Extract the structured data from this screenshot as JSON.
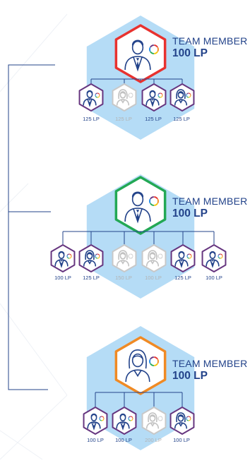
{
  "accent_color": "#23438a",
  "hexagon_fill": "#b5dcf6",
  "sub_hex_active_border": "#66357f",
  "sub_hex_inactive_border": "#c8c8c8",
  "groups": [
    {
      "role": "TEAM MEMBER",
      "points": "100 LP",
      "border_color": "#e8322f",
      "avatar": "male-icon",
      "subs": [
        {
          "label": "125 LP",
          "avatar": "male-icon",
          "active": true
        },
        {
          "label": "125 LP",
          "avatar": "female-icon",
          "active": false
        },
        {
          "label": "125 LP",
          "avatar": "male-icon",
          "active": true
        },
        {
          "label": "125 LP",
          "avatar": "female-icon",
          "active": true
        }
      ]
    },
    {
      "role": "TEAM MEMBER",
      "points": "100 LP",
      "border_color": "#23a855",
      "avatar": "male-icon",
      "subs": [
        {
          "label": "100 LP",
          "avatar": "male-icon",
          "active": true
        },
        {
          "label": "125 LP",
          "avatar": "female-icon",
          "active": true
        },
        {
          "label": "150 LP",
          "avatar": "female-icon",
          "active": false
        },
        {
          "label": "100 LP",
          "avatar": "female-icon",
          "active": false
        },
        {
          "label": "125 LP",
          "avatar": "male-icon",
          "active": true
        },
        {
          "label": "100 LP",
          "avatar": "male-icon",
          "active": true
        }
      ]
    },
    {
      "role": "TEAM MEMBER",
      "points": "100 LP",
      "border_color": "#f08a24",
      "avatar": "female-icon",
      "subs": [
        {
          "label": "100 LP",
          "avatar": "male-icon",
          "active": true
        },
        {
          "label": "100 LP",
          "avatar": "male-icon",
          "active": true
        },
        {
          "label": "200 LP",
          "avatar": "female-icon",
          "active": false
        },
        {
          "label": "100 LP",
          "avatar": "female-icon",
          "active": true
        }
      ]
    }
  ]
}
